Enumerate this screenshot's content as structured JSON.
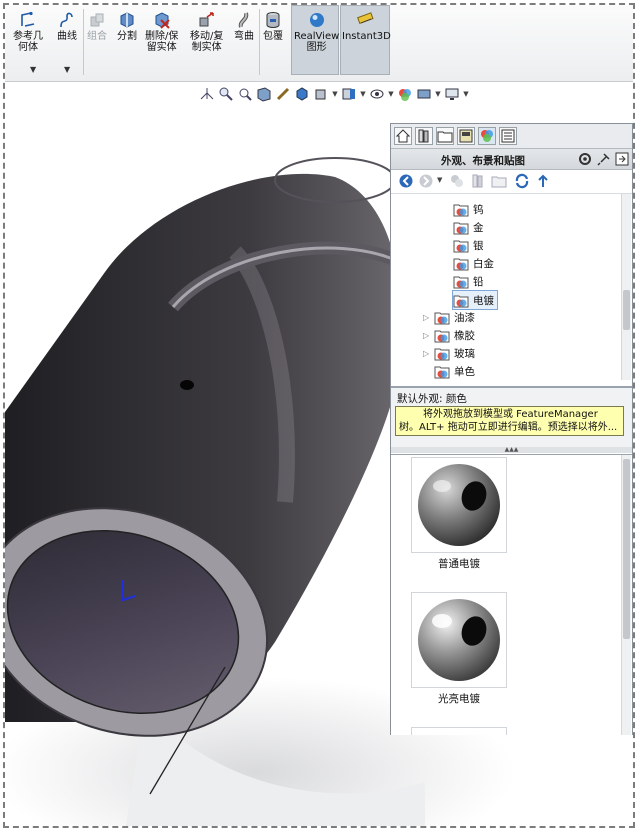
{
  "toolbar": {
    "items": [
      {
        "label_line1": "参考几",
        "label_line2": "何体",
        "icon": "reference-geometry-icon"
      },
      {
        "label_line1": "曲线",
        "label_line2": "",
        "icon": "curves-icon"
      },
      {
        "label_line1": "组合",
        "label_line2": "",
        "icon": "combine-icon",
        "disabled": true
      },
      {
        "label_line1": "分割",
        "label_line2": "",
        "icon": "split-icon"
      },
      {
        "label_line1": "删除/保",
        "label_line2": "留实体",
        "icon": "delete-keep-body-icon"
      },
      {
        "label_line1": "移动/复",
        "label_line2": "制实体",
        "icon": "move-copy-body-icon"
      },
      {
        "label_line1": "弯曲",
        "label_line2": "",
        "icon": "flex-icon"
      },
      {
        "label_line1": "包覆",
        "label_line2": "",
        "icon": "wrap-icon"
      },
      {
        "label_line1": "RealView",
        "label_line2": "图形",
        "icon": "realview-icon"
      },
      {
        "label_line1": "Instant3D",
        "label_line2": "",
        "icon": "instant3d-icon"
      }
    ]
  },
  "taskpane": {
    "title": "外观、布景和贴图",
    "tree": [
      {
        "label": "钨",
        "level": 2
      },
      {
        "label": "金",
        "level": 2
      },
      {
        "label": "银",
        "level": 2
      },
      {
        "label": "白金",
        "level": 2
      },
      {
        "label": "铅",
        "level": 2
      },
      {
        "label": "电镀",
        "level": 2,
        "selected": true
      },
      {
        "label": "油漆",
        "level": 1
      },
      {
        "label": "橡胶",
        "level": 1
      },
      {
        "label": "玻璃",
        "level": 1
      },
      {
        "label": "单色",
        "level": 1
      }
    ],
    "default_appearance": "默认外观: 颜色",
    "tooltip_line1": "将外观拖放到模型或 FeatureManager",
    "tooltip_line2": "树。ALT+ 拖动可立即进行编辑。预选择以将外...",
    "gallery": [
      {
        "label": "普通电镀"
      },
      {
        "label": "光亮电镀"
      }
    ]
  },
  "colors": {
    "toolbar_bg": "#eceef0",
    "selection": "#7ea6d8",
    "tooltip_bg": "#ffffb0",
    "part_dark": "#2e2d31"
  }
}
